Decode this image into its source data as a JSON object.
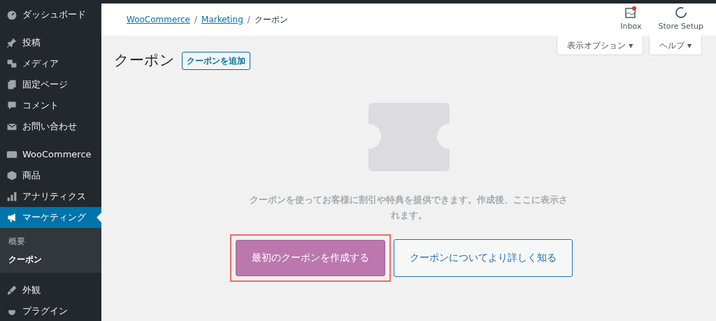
{
  "sidebar": {
    "groups": [
      {
        "items": [
          {
            "label": "ダッシュボード",
            "selected": false
          }
        ]
      },
      {
        "items": [
          {
            "label": "投稿",
            "selected": false
          },
          {
            "label": "メディア",
            "selected": false
          },
          {
            "label": "固定ページ",
            "selected": false
          },
          {
            "label": "コメント",
            "selected": false
          },
          {
            "label": "お問い合わせ",
            "selected": false
          }
        ]
      },
      {
        "items": [
          {
            "label": "WooCommerce",
            "selected": false
          },
          {
            "label": "商品",
            "selected": false
          },
          {
            "label": "アナリティクス",
            "selected": false
          },
          {
            "label": "マーケティング",
            "selected": true,
            "children": [
              {
                "label": "概要",
                "selected": false
              },
              {
                "label": "クーポン",
                "selected": true
              }
            ]
          }
        ]
      },
      {
        "items": [
          {
            "label": "外観",
            "selected": false
          },
          {
            "label": "プラグイン",
            "selected": false
          }
        ]
      }
    ]
  },
  "breadcrumb": [
    {
      "kind": "link",
      "label": "WooCommerce"
    },
    {
      "kind": "separator",
      "label": "/"
    },
    {
      "kind": "link",
      "label": "Marketing"
    },
    {
      "kind": "separator",
      "label": "/"
    },
    {
      "kind": "current",
      "label": "クーポン"
    }
  ],
  "header_actions": [
    {
      "label": "Inbox",
      "unread": true
    },
    {
      "label": "Store Setup",
      "unread": false
    }
  ],
  "screen_tabs": [
    "表示オプション ▾",
    "ヘルプ ▾"
  ],
  "page": {
    "title": "クーポン",
    "add_button": "クーポンを追加"
  },
  "empty_state": {
    "message": "クーポンを使ってお客様に割引や特典を提供できます。作成後、ここに表示されます。",
    "primary_button": "最初のクーポンを作成する",
    "secondary_button": "クーポンについてより詳しく知る"
  }
}
